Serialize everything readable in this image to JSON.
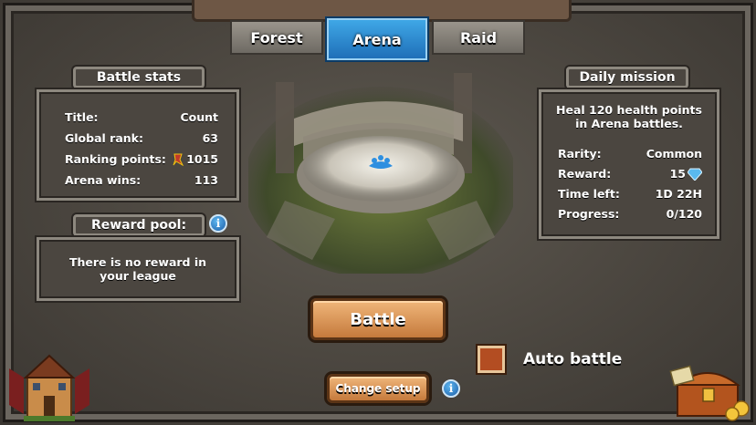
{
  "tabs": [
    {
      "label": "Forest",
      "active": false
    },
    {
      "label": "Arena",
      "active": true
    },
    {
      "label": "Raid",
      "active": false
    }
  ],
  "battle_stats": {
    "heading": "Battle stats",
    "rows": [
      {
        "label": "Title:",
        "value": "Count"
      },
      {
        "label": "Global rank:",
        "value": "63"
      },
      {
        "label": "Ranking points:",
        "value": "1015"
      },
      {
        "label": "Arena wins:",
        "value": "113"
      }
    ]
  },
  "reward_pool": {
    "heading": "Reward pool:",
    "message": "There is no reward in your league"
  },
  "daily_mission": {
    "heading": "Daily mission",
    "description": "Heal 120 health points in Arena battles.",
    "rows": [
      {
        "label": "Rarity:",
        "value": "Common"
      },
      {
        "label": "Reward:",
        "value": "15"
      },
      {
        "label": "Time left:",
        "value": "1D 22H"
      },
      {
        "label": "Progress:",
        "value": "0/120"
      }
    ]
  },
  "buttons": {
    "battle": "Battle",
    "change_setup": "Change setup",
    "auto_battle": "Auto battle"
  },
  "icons": {
    "info": "i"
  },
  "colors": {
    "tab_active": "#2a86cf",
    "button_wood": "#d98f4f",
    "checkbox": "#b34d22"
  }
}
